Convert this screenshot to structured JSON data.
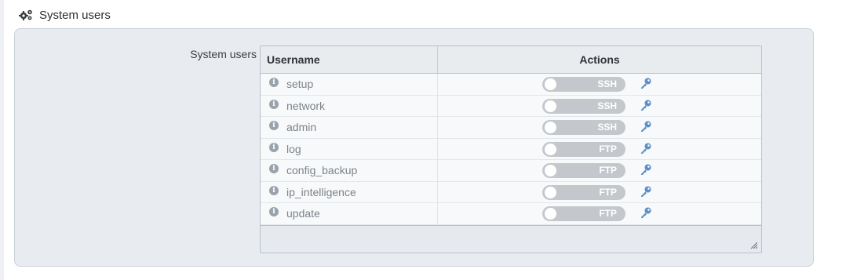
{
  "section": {
    "title": "System users",
    "icon": "gears-icon"
  },
  "field": {
    "label": "System users"
  },
  "table": {
    "headers": {
      "username": "Username",
      "actions": "Actions"
    },
    "rows": [
      {
        "username": "setup",
        "service": "SSH",
        "enabled": false
      },
      {
        "username": "network",
        "service": "SSH",
        "enabled": false
      },
      {
        "username": "admin",
        "service": "SSH",
        "enabled": false
      },
      {
        "username": "log",
        "service": "FTP",
        "enabled": false
      },
      {
        "username": "config_backup",
        "service": "FTP",
        "enabled": false
      },
      {
        "username": "ip_intelligence",
        "service": "FTP",
        "enabled": false
      },
      {
        "username": "update",
        "service": "FTP",
        "enabled": false
      }
    ]
  },
  "colors": {
    "accent": "#5b8fc7",
    "toggle_off": "#c4c8cc",
    "panel_bg": "#e8ecf0"
  }
}
